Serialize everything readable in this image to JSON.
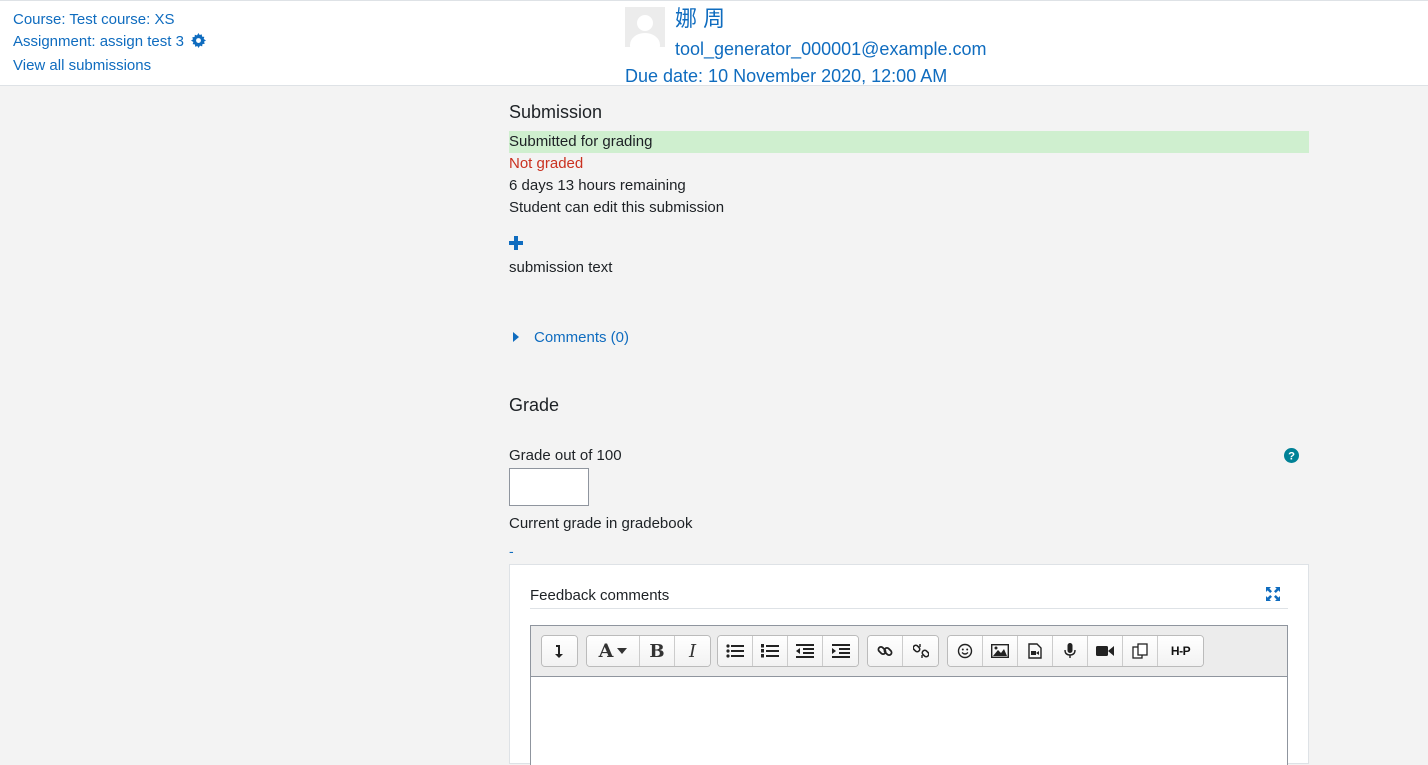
{
  "header": {
    "course_link": "Course: Test course: XS",
    "assignment_link": "Assignment: assign test 3",
    "view_all": "View all submissions",
    "user": {
      "name": "娜 周",
      "email": "tool_generator_000001@example.com",
      "due_date": "Due date: 10 November 2020, 12:00 AM"
    }
  },
  "submission": {
    "title": "Submission",
    "status_submitted": "Submitted for grading",
    "status_grading": "Not graded",
    "time_remaining": "6 days 13 hours remaining",
    "edit_status": "Student can edit this submission",
    "submission_text": "submission text",
    "comments_link": "Comments (0)"
  },
  "grade": {
    "title": "Grade",
    "grade_label": "Grade out of 100",
    "grade_value": "",
    "current_grade_label": "Current grade in gradebook",
    "current_grade_value": "-"
  },
  "feedback": {
    "title": "Feedback comments",
    "toolbar": {
      "groups": [
        [
          "show-more-buttons"
        ],
        [
          "font-style",
          "bold",
          "italic"
        ],
        [
          "unordered-list",
          "ordered-list",
          "outdent",
          "indent"
        ],
        [
          "link",
          "unlink"
        ],
        [
          "emoji",
          "image",
          "media",
          "record-audio",
          "record-video",
          "manage-files",
          "h5p"
        ]
      ],
      "h5p_label": "H-P"
    }
  },
  "colors": {
    "link": "#0f6cbf",
    "submitted_bg": "#cfefcf",
    "not_graded": "#ca3120",
    "help_icon": "#008196"
  }
}
